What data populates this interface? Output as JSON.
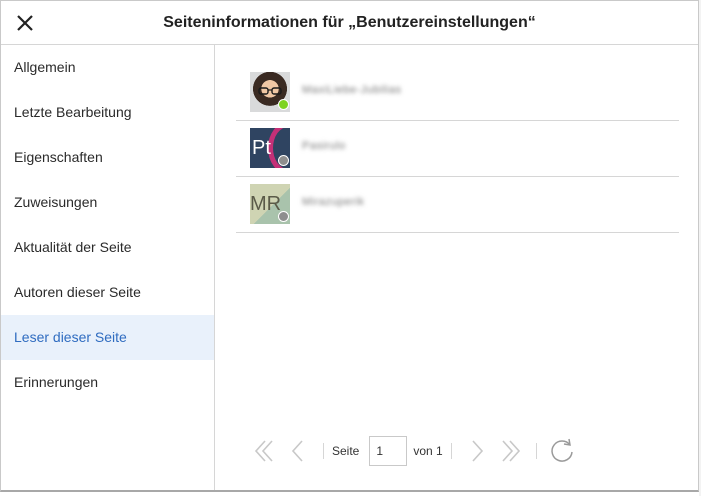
{
  "dialog": {
    "title": "Seiteninformationen für „Benutzereinstellungen“"
  },
  "sidebar": {
    "items": [
      {
        "label": "Allgemein"
      },
      {
        "label": "Letzte Bearbeitung"
      },
      {
        "label": "Eigenschaften"
      },
      {
        "label": "Zuweisungen"
      },
      {
        "label": "Aktualität der Seite"
      },
      {
        "label": "Autoren dieser Seite"
      },
      {
        "label": "Leser dieser Seite",
        "active": true
      },
      {
        "label": "Erinnerungen"
      }
    ]
  },
  "readers": [
    {
      "avatar_initials": "",
      "avatar_type": "photo",
      "status": "online",
      "name": "MaxiLiebe-Jubilias"
    },
    {
      "avatar_initials": "Pt",
      "avatar_type": "initials",
      "status": "offline",
      "name": "Pasirulo"
    },
    {
      "avatar_initials": "MR",
      "avatar_type": "initials",
      "status": "offline",
      "name": "Mirazuperik"
    }
  ],
  "pagination": {
    "page_label": "Seite",
    "current_page": "1",
    "of_label": "von 1"
  },
  "colors": {
    "accent": "#2f6cc0",
    "active_bg": "#e9f1fb",
    "online": "#7ed321",
    "offline": "#8e8e8e"
  },
  "icons": {
    "close": "close-icon",
    "first": "first-page-icon",
    "prev": "prev-page-icon",
    "next": "next-page-icon",
    "last": "last-page-icon",
    "refresh": "refresh-icon"
  }
}
